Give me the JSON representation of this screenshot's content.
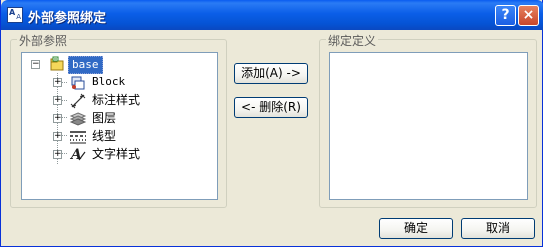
{
  "window": {
    "title": "外部参照绑定",
    "help_glyph": "?",
    "close_glyph": "×",
    "app_icon_glyph_a": "A",
    "app_icon_glyph_b": "A"
  },
  "xref_group": {
    "label": "外部参照",
    "tree": {
      "root": {
        "label": "base",
        "expander": "−"
      },
      "children": [
        {
          "label": "Block",
          "icon": "block-icon",
          "expander": "+"
        },
        {
          "label": "标注样式",
          "icon": "dimension-style-icon",
          "expander": "+"
        },
        {
          "label": "图层",
          "icon": "layers-icon",
          "expander": "+"
        },
        {
          "label": "线型",
          "icon": "linetype-icon",
          "expander": "+"
        },
        {
          "label": "文字样式",
          "icon": "text-style-icon",
          "expander": "+"
        }
      ]
    }
  },
  "definitions_group": {
    "label": "绑定定义"
  },
  "buttons": {
    "add": "添加(A) ->",
    "remove": "<- 删除(R)",
    "ok": "确定",
    "cancel": "取消"
  }
}
